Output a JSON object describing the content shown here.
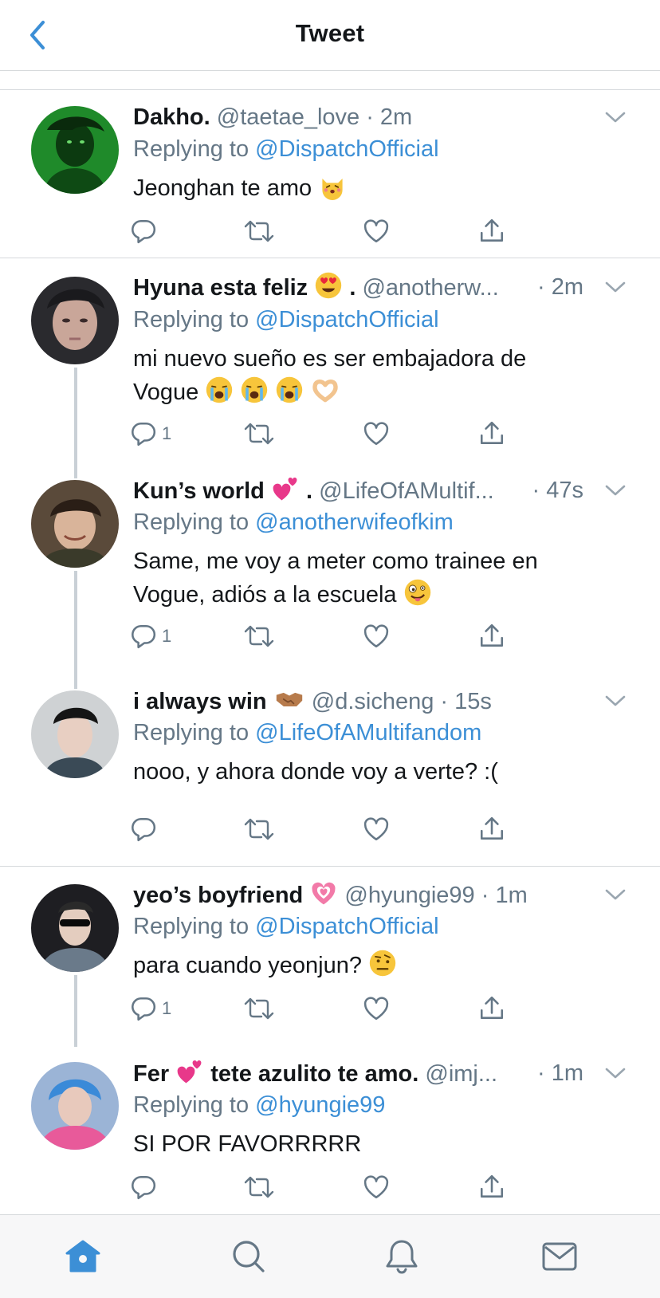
{
  "header": {
    "title": "Tweet"
  },
  "colors": {
    "accent": "#3c8fd6",
    "secondary_text": "#657786",
    "divider": "#d6d9dc",
    "thread_line": "#c9d0d6"
  },
  "tweets": [
    {
      "name": "Dakho.",
      "handle": "@taetae_love",
      "time": "· 2m",
      "replying_prefix": "Replying to",
      "replying_to": "@DispatchOfficial",
      "text": "Jeonghan te amo",
      "reply_count": "",
      "emoji": [
        "kissing-cat-emoji"
      ]
    },
    {
      "name": "Hyuna esta feliz",
      "name_suffix": ".",
      "handle": "@anotherw...",
      "time": "· 2m",
      "replying_prefix": "Replying to",
      "replying_to": "@DispatchOfficial",
      "text_line1": "mi nuevo sueño es ser embajadora de",
      "text_line2": "Vogue",
      "reply_count": "1",
      "emoji": [
        "heart-eyes-emoji",
        "crying-emoji",
        "crying-emoji",
        "crying-emoji",
        "heart-hands-emoji"
      ]
    },
    {
      "name": "Kun’s world",
      "name_suffix": ".",
      "handle": "@LifeOfAMultif...",
      "time": "· 47s",
      "replying_prefix": "Replying to",
      "replying_to": "@anotherwifeofkim",
      "text_line1": "Same, me voy a meter como trainee en",
      "text_line2": "Vogue, adiós a la escuela",
      "reply_count": "1",
      "emoji": [
        "two-hearts-emoji",
        "zany-face-emoji"
      ]
    },
    {
      "name": "i always win",
      "handle": "@d.sicheng",
      "time": "· 15s",
      "replying_prefix": "Replying to",
      "replying_to": "@LifeOfAMultifandom",
      "text": "nooo, y ahora donde voy a verte? :(",
      "reply_count": "",
      "emoji": [
        "handshake-emoji"
      ]
    },
    {
      "name": "yeo’s boyfriend",
      "handle": "@hyungie99",
      "time": "· 1m",
      "replying_prefix": "Replying to",
      "replying_to": "@DispatchOfficial",
      "text": "para cuando yeonjun?",
      "reply_count": "1",
      "emoji": [
        "growing-heart-emoji",
        "raised-eyebrow-emoji"
      ]
    },
    {
      "name": "Fer",
      "name_part2": "tete azulito te amo.",
      "handle": "@imj...",
      "time": "· 1m",
      "replying_prefix": "Replying to",
      "replying_to": "@hyungie99",
      "text": "SI POR FAVORRRRR",
      "reply_count": "",
      "emoji": [
        "two-hearts-emoji"
      ]
    }
  ],
  "tabbar": {
    "items": [
      "home-icon",
      "search-icon",
      "notifications-icon",
      "messages-icon"
    ],
    "active": "home-icon"
  }
}
